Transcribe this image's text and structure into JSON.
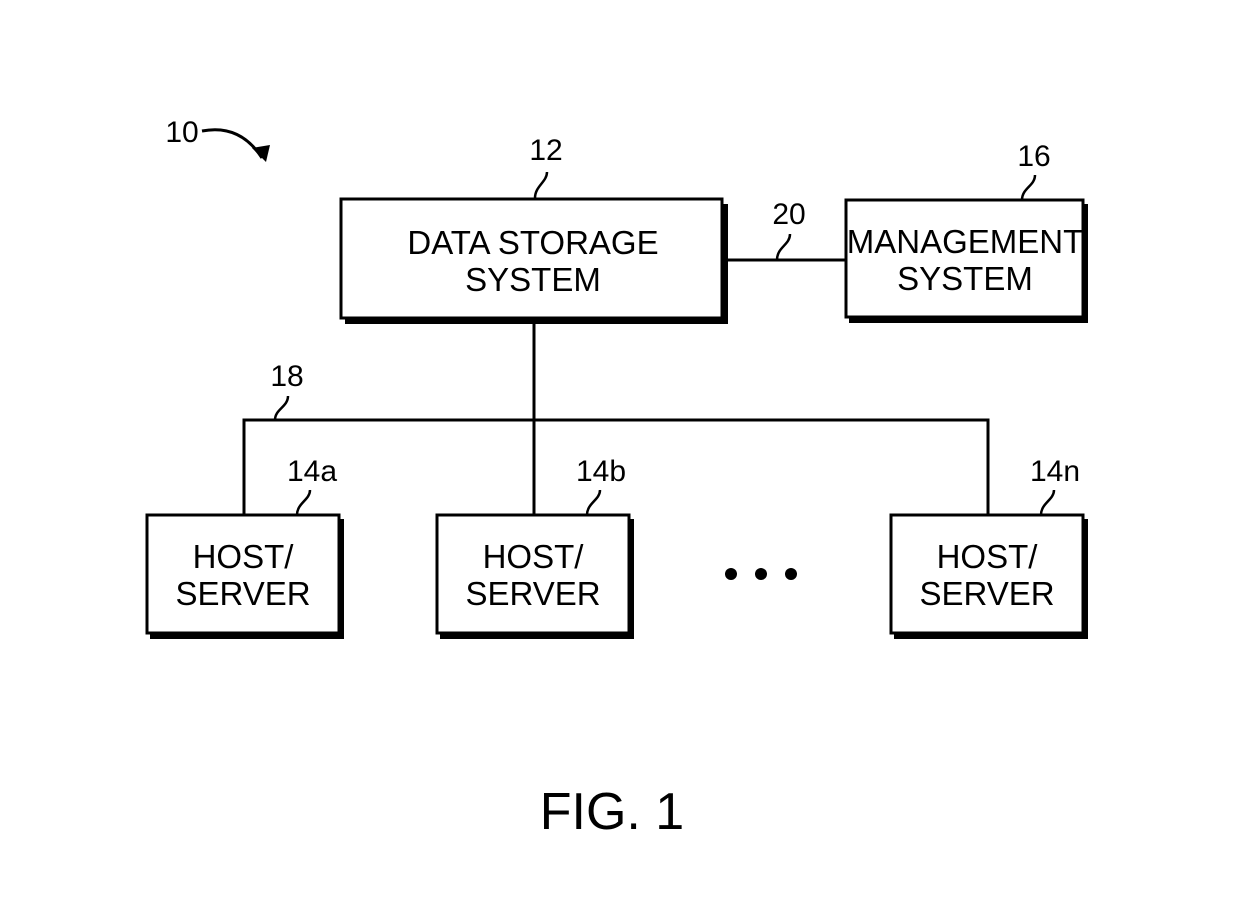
{
  "figure": {
    "caption": "FIG. 1",
    "system_ref": "10"
  },
  "nodes": {
    "data_storage": {
      "ref": "12",
      "line1": "DATA STORAGE",
      "line2": "SYSTEM"
    },
    "management": {
      "ref": "16",
      "line1": "MANAGEMENT",
      "line2": "SYSTEM"
    },
    "host_a": {
      "ref": "14a",
      "line1": "HOST/",
      "line2": "SERVER"
    },
    "host_b": {
      "ref": "14b",
      "line1": "HOST/",
      "line2": "SERVER"
    },
    "host_n": {
      "ref": "14n",
      "line1": "HOST/",
      "line2": "SERVER"
    }
  },
  "connections": {
    "mgmt_link": {
      "ref": "20"
    },
    "host_bus": {
      "ref": "18"
    }
  },
  "ellipsis": "• • •"
}
